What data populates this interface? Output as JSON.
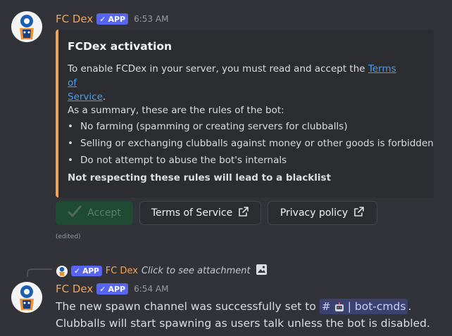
{
  "message1": {
    "username": "FC Dex",
    "badge": "APP",
    "timestamp": "6:53 AM",
    "embed": {
      "title": "FCDex activation",
      "intro_text": "To enable FCDex in your server, you must read and accept the ",
      "intro_link": "Terms of",
      "intro_link_2": "Service",
      "intro_end": ".",
      "summary": "As a summary, these are the rules of the bot:",
      "rules": [
        "No farming (spamming or creating servers for clubballs)",
        "Selling or exchanging clubballs against money or other goods is forbidden",
        "Do not attempt to abuse the bot's internals"
      ],
      "footer_bold": "Not respecting these rules will lead to a blacklist"
    },
    "buttons": {
      "accept": "Accept",
      "terms": "Terms of Service",
      "privacy": "Privacy policy"
    },
    "edited": "(edited)"
  },
  "reply": {
    "badge": "APP",
    "username": "FC Dex",
    "text": "Click to see attachment"
  },
  "message2": {
    "username": "FC Dex",
    "badge": "APP",
    "timestamp": "6:54 AM",
    "line1_prefix": "The new spawn channel was successfully set to",
    "channel_hash": "#",
    "channel_name": "| bot-cmds",
    "line1_suffix": ".",
    "line2": "Clubballs will start spawning as users talk unless the bot is disabled."
  },
  "colors": {
    "background": "#313338",
    "username": "#f0a35a",
    "badge": "#5865f2",
    "link": "#4e9ded",
    "embed_accent": "#f0a35a"
  }
}
